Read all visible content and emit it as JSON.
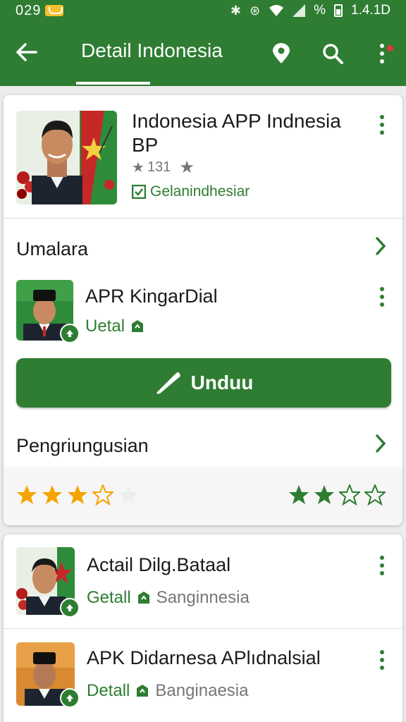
{
  "status_bar": {
    "time": "029",
    "percent": "%",
    "version": "1.4.1D"
  },
  "app_bar": {
    "title": "Detail Indonesia"
  },
  "featured": {
    "name": "Indonesia APP Indnesia BP",
    "rating_text": "131",
    "developer": "Gelanindhesiar"
  },
  "section1": {
    "title": "Umalara"
  },
  "related": {
    "name": "APR KingarDial",
    "tag": "Uetal"
  },
  "download": {
    "label": "Unduu"
  },
  "section2": {
    "title": "Pengriungusian"
  },
  "ratings": {
    "left": {
      "filled": 3,
      "outline": 1,
      "faded": 1
    },
    "right": {
      "filled": 2,
      "outline": 2
    }
  },
  "list": [
    {
      "name": "Actail Dilg.Bataal",
      "tag": "Getall",
      "category": "Sanginnesia"
    },
    {
      "name": "APK Didarnesa APlıdnalsial",
      "tag": "Detall",
      "category": "Banginaesia"
    }
  ],
  "colors": {
    "primary": "#2e7d32",
    "star_gold": "#f5a300",
    "notif_red": "#e53935"
  }
}
